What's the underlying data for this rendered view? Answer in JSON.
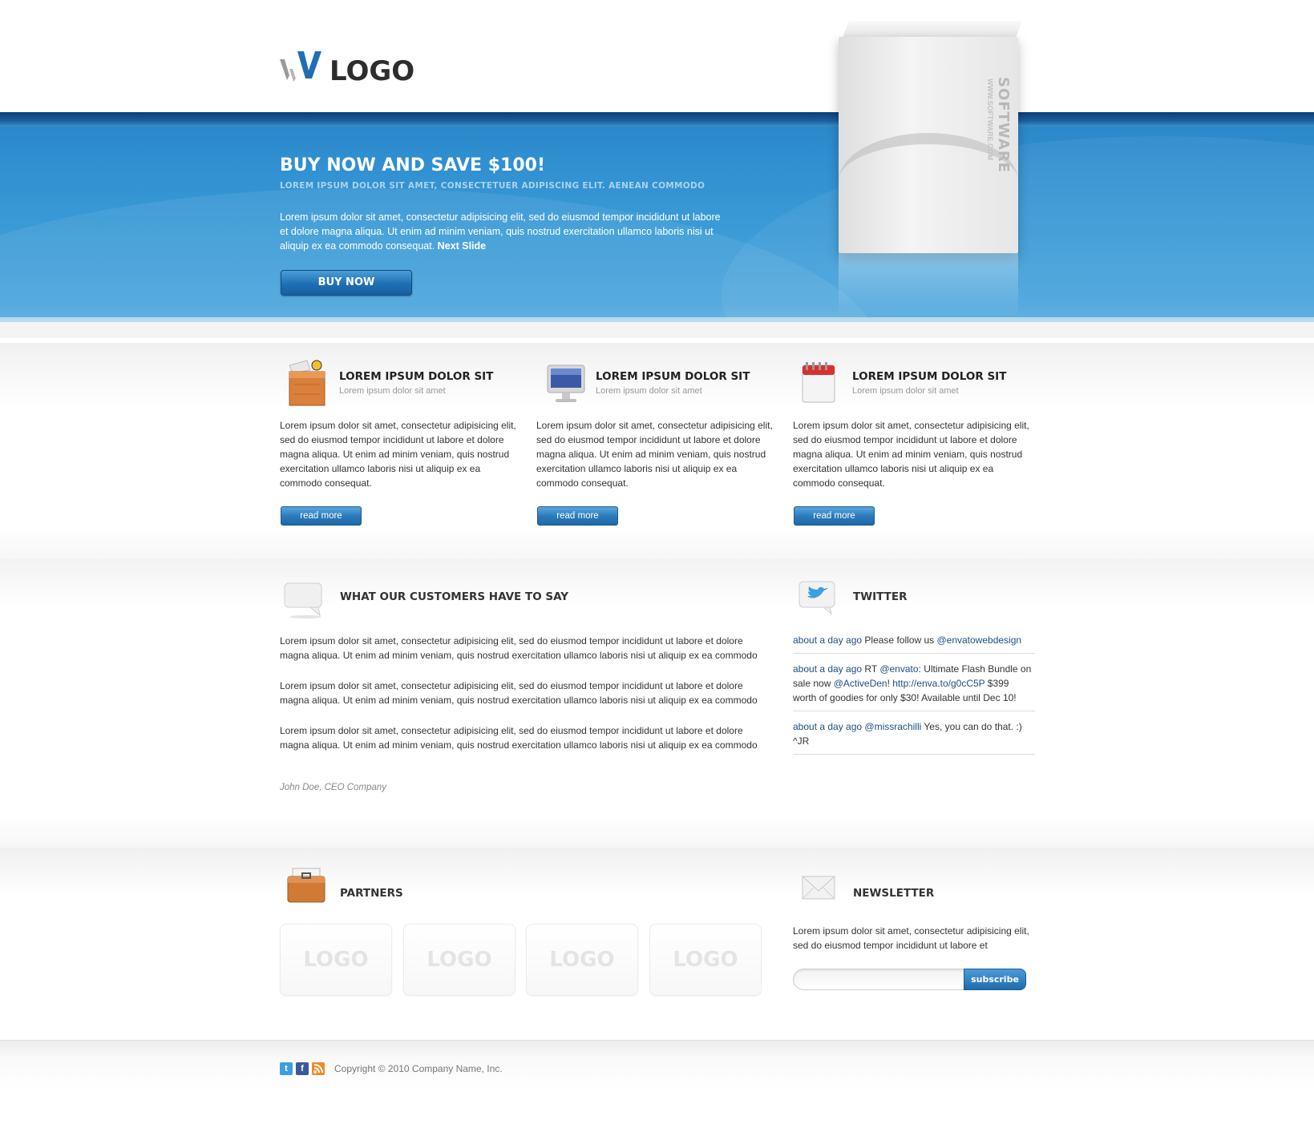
{
  "header": {
    "logo_text": "LOGO"
  },
  "hero": {
    "title": "BUY NOW AND SAVE $100!",
    "subtitle": "LOREM IPSUM DOLOR SIT AMET, CONSECTETUER ADIPISCING ELIT. AENEAN COMMODO",
    "text": "Lorem ipsum dolor sit amet, consectetur adipisicing elit, sed do eiusmod tempor incididunt ut labore et dolore magna aliqua. Ut enim ad minim veniam, quis nostrud exercitation ullamco laboris nisi ut aliquip ex ea commodo consequat.",
    "next_link": "Next Slide",
    "buy_button": "BUY NOW",
    "box_label": "SOFTWARE",
    "box_url": "WWW.SOFTWARE.COM"
  },
  "features": [
    {
      "icon": "package-box-icon",
      "title": "LOREM IPSUM DOLOR SIT",
      "subtitle": "Lorem ipsum dolor sit amet",
      "text": "Lorem ipsum dolor sit amet, consectetur adipisicing elit, sed do eiusmod tempor incididunt ut labore et dolore magna aliqua. Ut enim ad minim veniam, quis nostrud exercitation ullamco laboris nisi ut aliquip ex ea commodo consequat.",
      "button": "read more"
    },
    {
      "icon": "monitor-icon",
      "title": "LOREM IPSUM DOLOR SIT",
      "subtitle": "Lorem ipsum dolor sit amet",
      "text": "Lorem ipsum dolor sit amet, consectetur adipisicing elit, sed do eiusmod tempor incididunt ut labore et dolore magna aliqua. Ut enim ad minim veniam, quis nostrud exercitation ullamco laboris nisi ut aliquip ex ea commodo consequat.",
      "button": "read more"
    },
    {
      "icon": "calendar-icon",
      "title": "LOREM IPSUM DOLOR SIT",
      "subtitle": "Lorem ipsum dolor sit amet",
      "text": "Lorem ipsum dolor sit amet, consectetur adipisicing elit, sed do eiusmod tempor incididunt ut labore et dolore magna aliqua. Ut enim ad minim veniam, quis nostrud exercitation ullamco laboris nisi ut aliquip ex ea commodo consequat.",
      "button": "read more"
    }
  ],
  "testimonials": {
    "title": "WHAT OUR CUSTOMERS HAVE TO SAY",
    "paragraphs": [
      "Lorem ipsum dolor sit amet, consectetur adipisicing elit, sed do eiusmod tempor incididunt ut labore et dolore magna aliqua. Ut enim ad minim veniam, quis nostrud exercitation ullamco laboris nisi ut aliquip ex ea commodo",
      "Lorem ipsum dolor sit amet, consectetur adipisicing elit, sed do eiusmod tempor incididunt ut labore et dolore magna aliqua. Ut enim ad minim veniam, quis nostrud exercitation ullamco laboris nisi ut aliquip ex ea commodo",
      "Lorem ipsum dolor sit amet, consectetur adipisicing elit, sed do eiusmod tempor incididunt ut labore et dolore magna aliqua. Ut enim ad minim veniam, quis nostrud exercitation ullamco laboris nisi ut aliquip ex ea commodo"
    ],
    "author": "John Doe, CEO Company"
  },
  "twitter": {
    "title": "TWITTER",
    "tweets": [
      {
        "time": "about a day ago",
        "text_before": " Please follow us ",
        "link": "@envatowebdesign",
        "text_after": ""
      },
      {
        "time": "about a day ago",
        "text_before": " RT ",
        "link": "@envato",
        "text_after": ": Ultimate Flash Bundle on sale now ",
        "link2": "@ActiveDen",
        "text2": "! ",
        "link3": "http://enva.to/g0cC5P",
        "text3": " $399 worth of goodies for only $30! Available until Dec 10!"
      },
      {
        "time": "about a day ago",
        "text_before": " ",
        "link": "@missrachilli",
        "text_after": " Yes, you can do that. :) ^JR"
      }
    ]
  },
  "partners": {
    "title": "PARTNERS",
    "logos": [
      "LOGO",
      "LOGO",
      "LOGO",
      "LOGO"
    ]
  },
  "newsletter": {
    "title": "NEWSLETTER",
    "text": "Lorem ipsum dolor sit amet, consectetur adipisicing elit, sed do eiusmod tempor incididunt ut labore et",
    "input_value": "",
    "button": "subscribe"
  },
  "footer": {
    "social_icons": [
      "twitter-icon",
      "facebook-icon",
      "rss-icon"
    ],
    "copyright": "Copyright © 2010 Company Name, Inc."
  },
  "colors": {
    "accent": "#2a78b8",
    "hero_blue": "#3a9ad6",
    "link": "#1c4f82"
  }
}
